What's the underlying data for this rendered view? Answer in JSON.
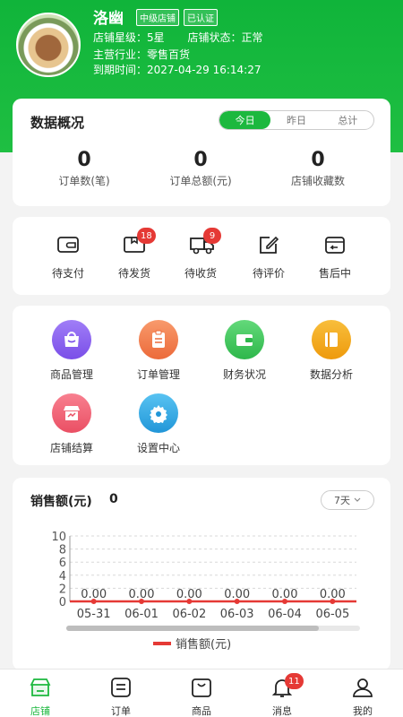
{
  "header": {
    "shop_name": "洛幽",
    "badges": [
      "中级店铺",
      "已认证"
    ],
    "star_label": "店铺星级：",
    "star_value": "5星",
    "status_label": "店铺状态：",
    "status_value": "正常",
    "industry_label": "主营行业：",
    "industry_value": "零售百货",
    "expire_label": "到期时间：",
    "expire_value": "2027-04-29 16:14:27"
  },
  "overview": {
    "title": "数据概况",
    "tabs": [
      "今日",
      "昨日",
      "总计"
    ],
    "active_tab": "今日",
    "stats": [
      {
        "value": "0",
        "label": "订单数(笔)"
      },
      {
        "value": "0",
        "label": "订单总额(元)"
      },
      {
        "value": "0",
        "label": "店铺收藏数"
      }
    ]
  },
  "orders": {
    "items": [
      {
        "label": "待支付",
        "icon": "wallet-icon",
        "badge": ""
      },
      {
        "label": "待发货",
        "icon": "package-icon",
        "badge": "18"
      },
      {
        "label": "待收货",
        "icon": "truck-icon",
        "badge": "9"
      },
      {
        "label": "待评价",
        "icon": "edit-icon",
        "badge": ""
      },
      {
        "label": "售后中",
        "icon": "return-box-icon",
        "badge": ""
      }
    ]
  },
  "functions": {
    "items": [
      {
        "label": "商品管理",
        "icon": "bag-icon",
        "color": "#8a5cf6"
      },
      {
        "label": "订单管理",
        "icon": "clipboard-icon",
        "color": "#f07a4a"
      },
      {
        "label": "财务状况",
        "icon": "wallet-icon",
        "color": "#3cc65a"
      },
      {
        "label": "数据分析",
        "icon": "book-icon",
        "color": "#f2a516"
      },
      {
        "label": "店铺结算",
        "icon": "store-icon",
        "color": "#f05a6a"
      },
      {
        "label": "设置中心",
        "icon": "gear-icon",
        "color": "#2fa8e8"
      }
    ]
  },
  "sales": {
    "title": "销售额(元)",
    "value": "0",
    "range": "7天"
  },
  "chart_data": {
    "type": "line",
    "categories": [
      "05-31",
      "06-01",
      "06-02",
      "06-03",
      "06-04",
      "06-05"
    ],
    "series": [
      {
        "name": "销售额(元)",
        "values": [
          0,
          0,
          0,
          0,
          0,
          0
        ],
        "color": "#e53935"
      }
    ],
    "data_labels": [
      "0.00",
      "0.00",
      "0.00",
      "0.00",
      "0.00",
      "0.00"
    ],
    "yticks": [
      "0",
      "2",
      "4",
      "6",
      "8",
      "10"
    ],
    "ylim": [
      0,
      10
    ],
    "legend": "bottom"
  },
  "tabbar": {
    "items": [
      {
        "label": "店铺",
        "icon": "store-icon",
        "active": true,
        "badge": ""
      },
      {
        "label": "订单",
        "icon": "list-icon",
        "active": false,
        "badge": ""
      },
      {
        "label": "商品",
        "icon": "bag-icon",
        "active": false,
        "badge": ""
      },
      {
        "label": "消息",
        "icon": "bell-icon",
        "active": false,
        "badge": "11"
      },
      {
        "label": "我的",
        "icon": "user-icon",
        "active": false,
        "badge": ""
      }
    ]
  }
}
